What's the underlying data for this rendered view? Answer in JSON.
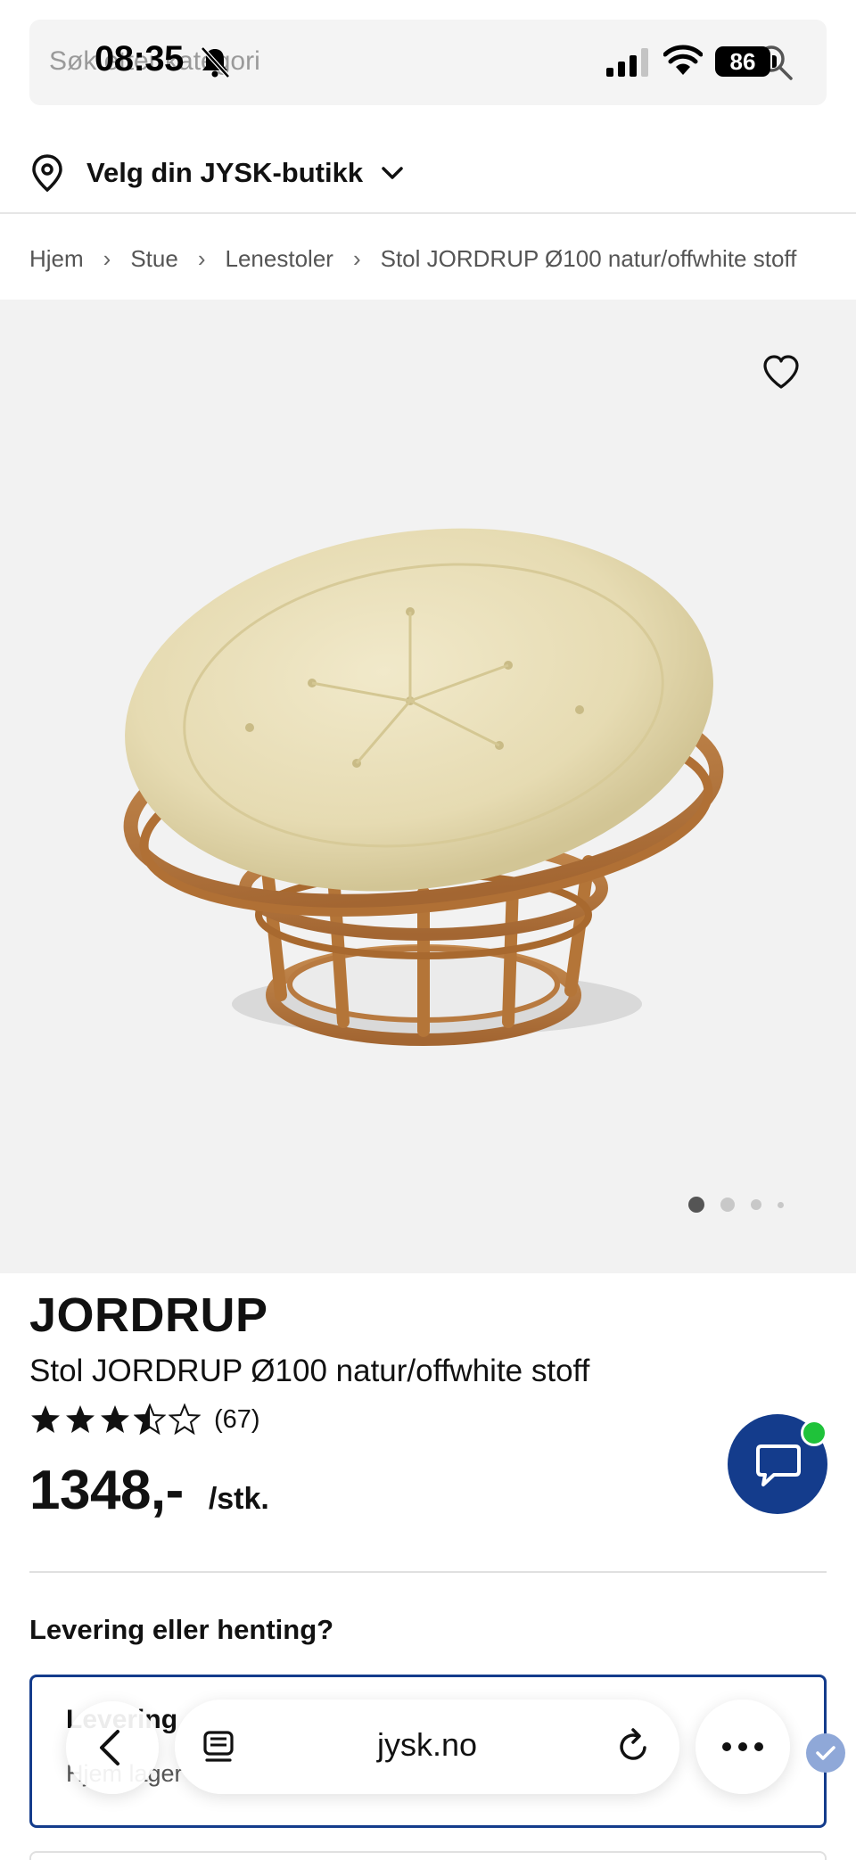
{
  "status_bar": {
    "time": "08:35",
    "battery": "86"
  },
  "search": {
    "placeholder": "Søk etter kategori"
  },
  "store": {
    "label": "Velg din JYSK-butikk"
  },
  "breadcrumb": [
    "Hjem",
    "Stue",
    "Lenestoler",
    "Stol JORDRUP Ø100 natur/offwhite stoff"
  ],
  "gallery": {
    "image_count": 4,
    "active_index": 0
  },
  "product": {
    "brand": "JORDRUP",
    "name": "Stol JORDRUP Ø100 natur/offwhite stoff",
    "rating_stars": 3.5,
    "rating_count": "(67)",
    "price": "1348,-",
    "unit": "/stk."
  },
  "delivery": {
    "title": "Levering eller henting?",
    "option_title": "Levering",
    "option_sub": "Hjem lager"
  },
  "browser": {
    "url": "jysk.no"
  },
  "colors": {
    "accent": "#143c8c",
    "online": "#1fc23a",
    "gallery_bg": "#f2f2f2"
  }
}
